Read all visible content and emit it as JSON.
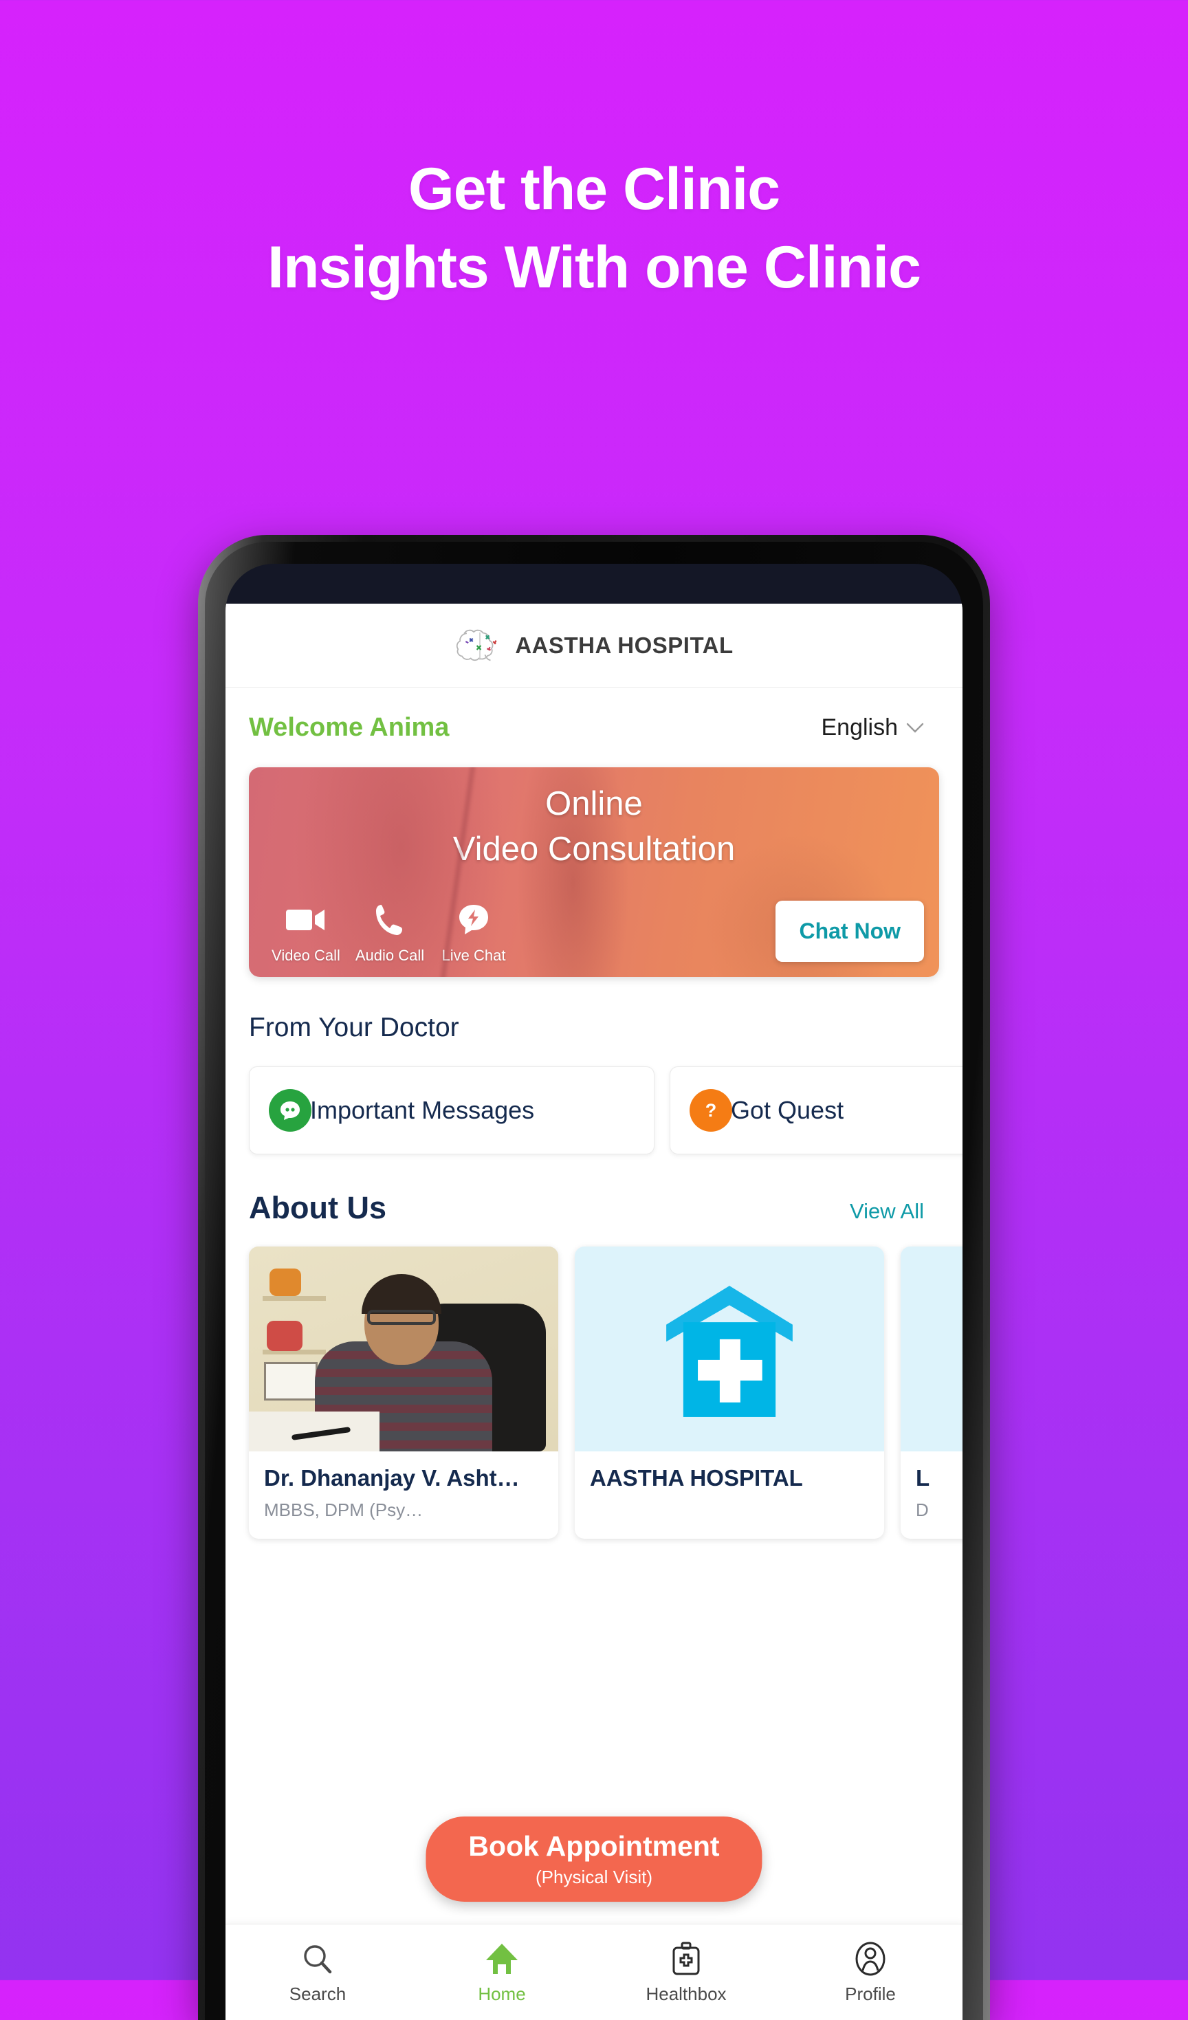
{
  "promo": {
    "headline_line1": "Get the Clinic",
    "headline_line2": "Insights With one Clinic",
    "background_top": "#D622FC",
    "background_bottom": "#9333F0"
  },
  "app": {
    "header": {
      "logo_icon": "brain-logo-icon",
      "hospital_name": "AASTHA HOSPITAL"
    },
    "welcome": {
      "greeting": "Welcome Anima",
      "greeting_color": "#72C042",
      "language": "English",
      "language_chevron": "chevron-down-icon"
    },
    "banner": {
      "title_line1": "Online",
      "title_line2": "Video Consultation",
      "actions": [
        {
          "icon": "video-camera-icon",
          "label": "Video Call"
        },
        {
          "icon": "phone-icon",
          "label": "Audio Call"
        },
        {
          "icon": "lightning-chat-icon",
          "label": "Live Chat"
        }
      ],
      "cta_label": "Chat Now",
      "cta_color": "#0E9AA7"
    },
    "from_doctor": {
      "title": "From Your Doctor",
      "cards": [
        {
          "icon": "chat-bubble-icon",
          "icon_color": "#27A33F",
          "label": "Important Messages"
        },
        {
          "icon": "question-mark-icon",
          "icon_color": "#F57C14",
          "label": "Got Quest"
        }
      ]
    },
    "about_us": {
      "title": "About Us",
      "view_all_label": "View All",
      "view_all_color": "#0E9AA7",
      "cards": [
        {
          "image": "doctor-portrait-photo",
          "name": "Dr. Dhananjay V. Asht…",
          "subtitle": "MBBS, DPM (Psy…"
        },
        {
          "image": "hospital-building-icon",
          "name": "AASTHA HOSPITAL",
          "subtitle": ""
        },
        {
          "image": "hospital-building-icon",
          "name": "L",
          "subtitle": "D"
        }
      ]
    },
    "book_appointment": {
      "main_label": "Book Appointment",
      "sub_label": "(Physical Visit)",
      "color": "#F3674F"
    },
    "bottom_nav": {
      "active_color": "#72C042",
      "items": [
        {
          "icon": "search-icon",
          "label": "Search",
          "active": false
        },
        {
          "icon": "home-icon",
          "label": "Home",
          "active": true
        },
        {
          "icon": "healthbox-icon",
          "label": "Healthbox",
          "active": false
        },
        {
          "icon": "profile-icon",
          "label": "Profile",
          "active": false
        }
      ]
    }
  }
}
